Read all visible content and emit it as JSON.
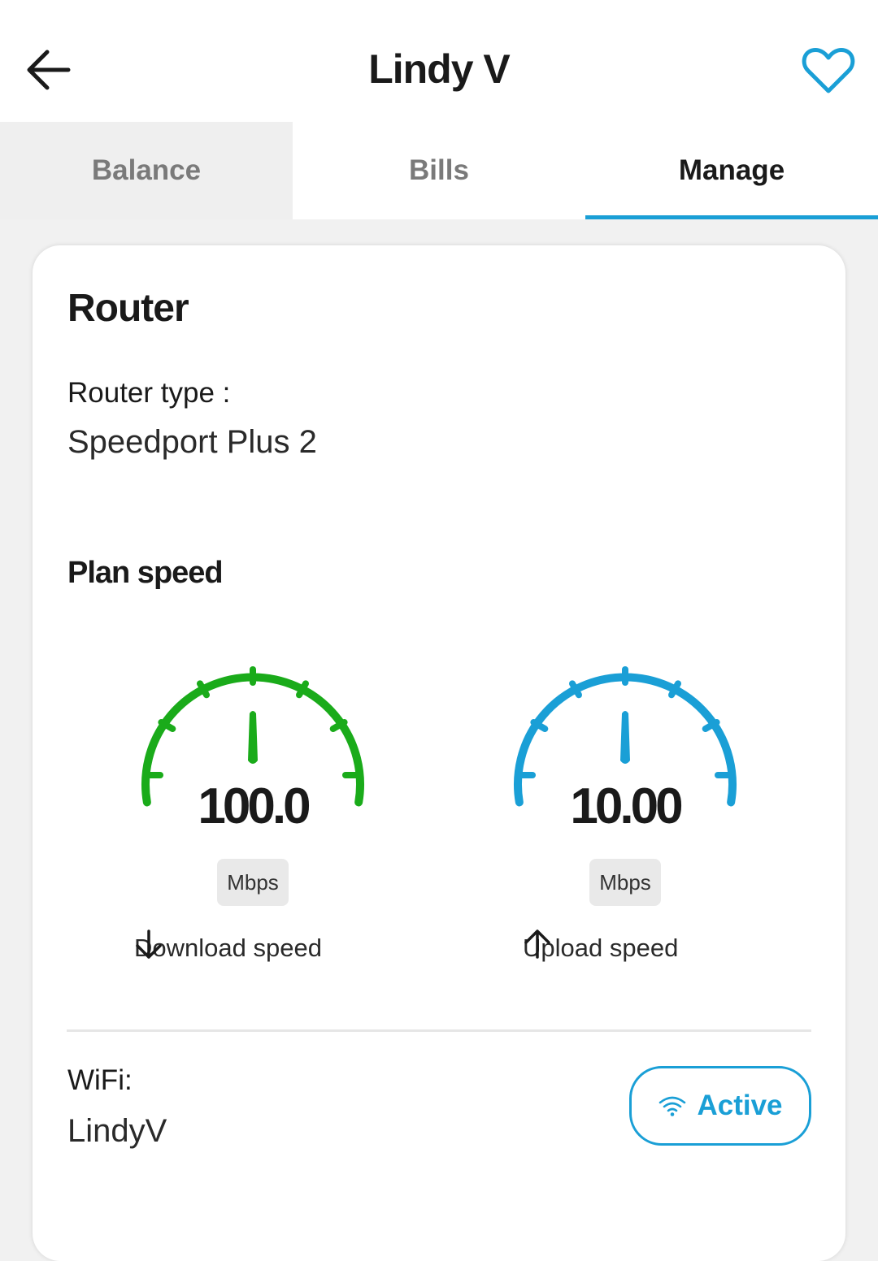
{
  "header": {
    "title": "Lindy V"
  },
  "tabs": [
    {
      "label": "Balance"
    },
    {
      "label": "Bills"
    },
    {
      "label": "Manage"
    }
  ],
  "router": {
    "title": "Router",
    "type_label": "Router type :",
    "type_value": "Speedport Plus 2",
    "plan_speed_title": "Plan speed",
    "download": {
      "value": "100.0",
      "unit": "Mbps",
      "label": "Download speed",
      "color": "#1aab1a"
    },
    "upload": {
      "value": "10.00",
      "unit": "Mbps",
      "label": "Upload speed",
      "color": "#1a9fd6"
    },
    "wifi_label": "WiFi:",
    "wifi_name": "LindyV",
    "wifi_status": "Active"
  },
  "colors": {
    "accent": "#1a9fd6",
    "download": "#1aab1a"
  }
}
